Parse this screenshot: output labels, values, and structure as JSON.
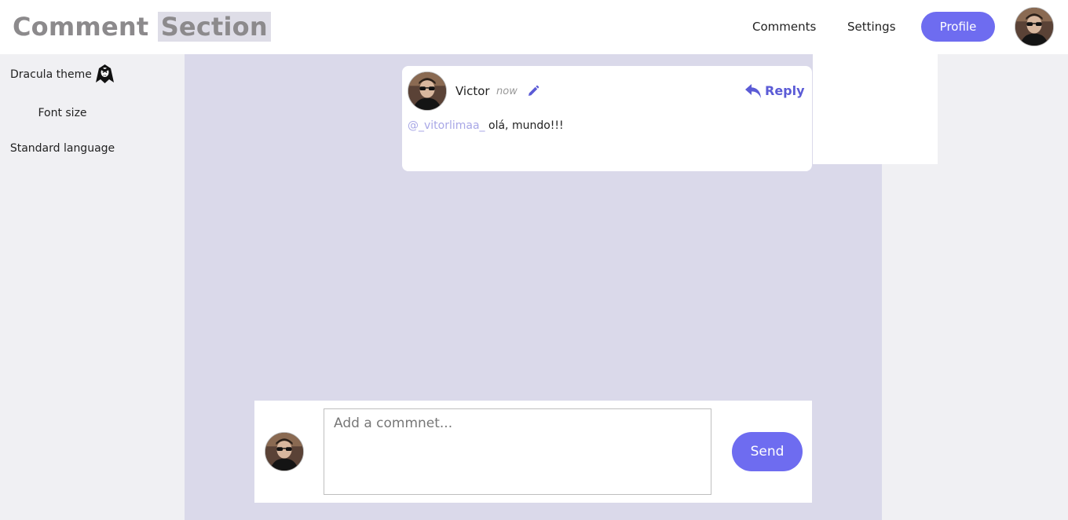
{
  "header": {
    "brand_word1": "Comment",
    "brand_word2": "Section",
    "nav_comments": "Comments",
    "nav_settings": "Settings",
    "profile_label": "Profile"
  },
  "settings_menu": {
    "dracula_label": "Dracula theme",
    "font_size_label": "Font size",
    "language_label": "Standard language"
  },
  "comment": {
    "author": "Victor",
    "time": "now",
    "reply_label": "Reply",
    "mention": "@_vitorlimaa_",
    "text": "olá, mundo!!!"
  },
  "composer": {
    "placeholder": "Add a commnet...",
    "send_label": "Send"
  },
  "colors": {
    "accent": "#6e6cf0",
    "reply": "#5b5bd6",
    "mention": "#a8a7e6",
    "page_column": "#dad9ea"
  },
  "icons": {
    "edit": "pencil-icon",
    "reply": "reply-arrow-icon",
    "dracula": "dracula-icon"
  }
}
